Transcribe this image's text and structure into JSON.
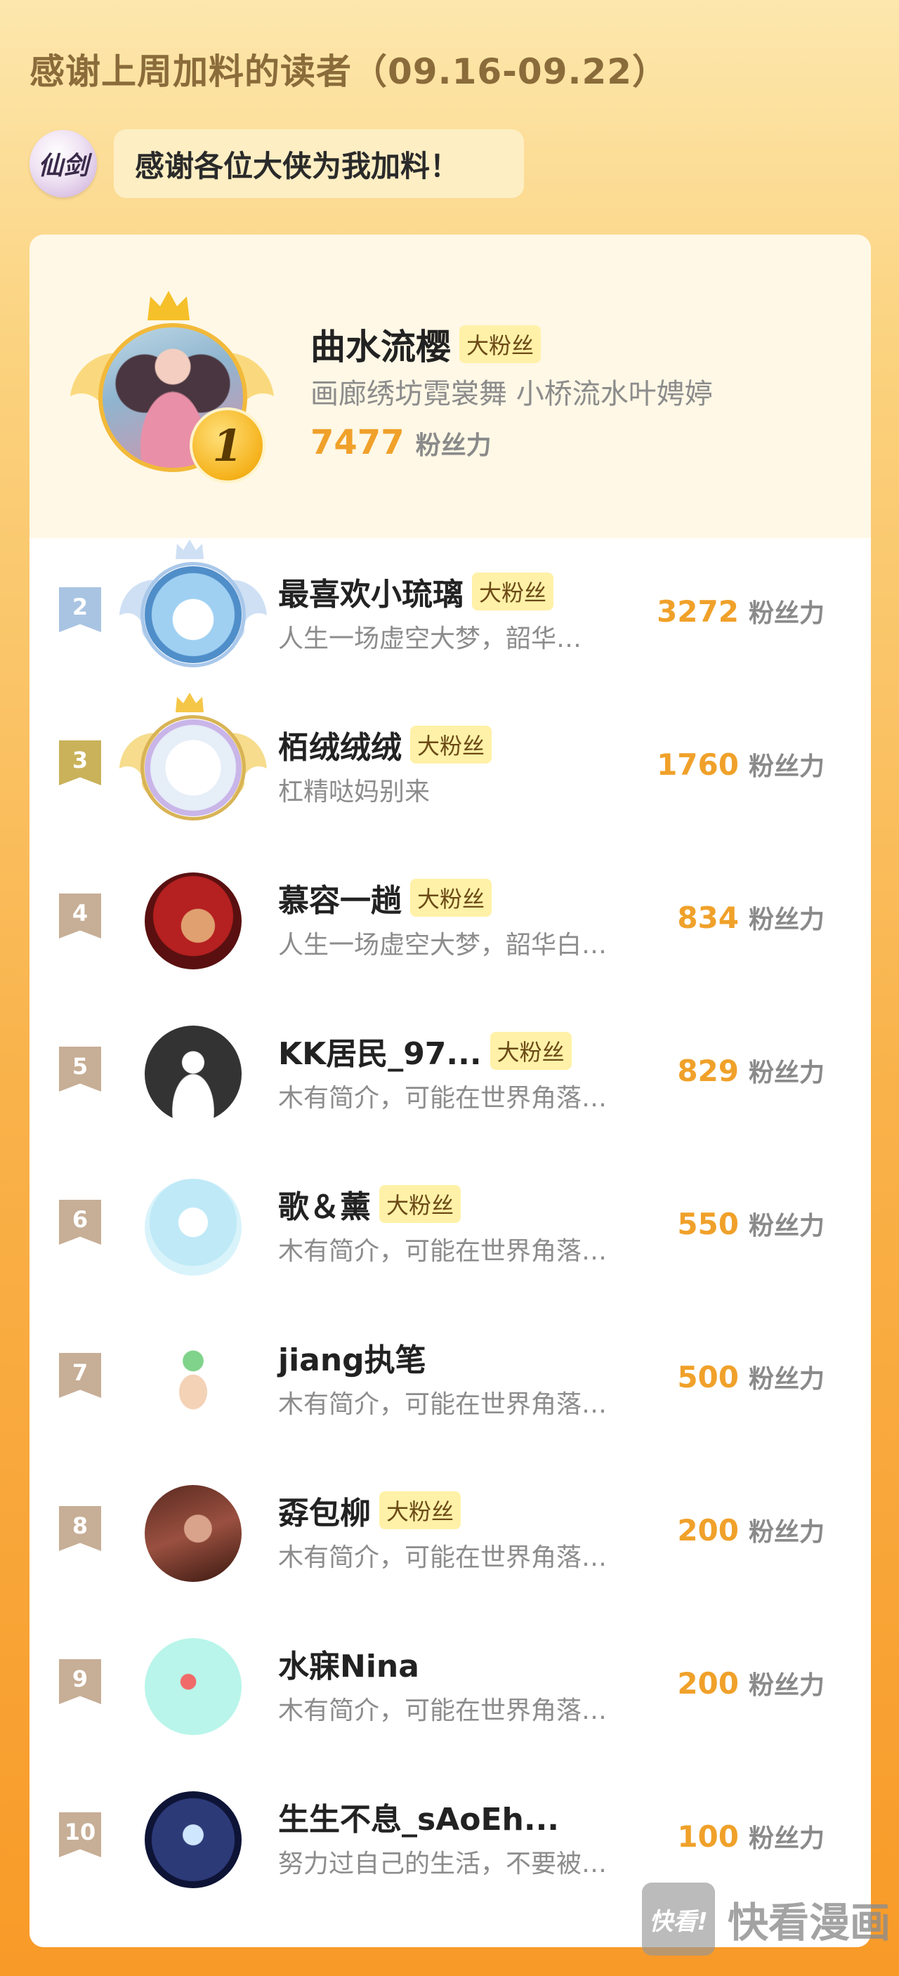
{
  "header": {
    "title": "感谢上周加料的读者（09.16-09.22）",
    "host_avatar_text": "仙剑",
    "speech": "感谢各位大侠为我加料！"
  },
  "unit_label": "粉丝力",
  "top": {
    "rank": "1",
    "name": "曲水流樱",
    "tag": "大粉丝",
    "bio": "画廊绣坊霓裳舞 小桥流水叶娉婷",
    "score": "7477"
  },
  "rows": [
    {
      "rank": "2",
      "name": "最喜欢小琉璃",
      "tag": "大粉丝",
      "bio": "人生一场虚空大梦，韶华…",
      "score": "3272",
      "flag_color": "#a9c4e2"
    },
    {
      "rank": "3",
      "name": "栢绒绒绒",
      "tag": "大粉丝",
      "bio": "杠精哒妈别来",
      "score": "1760",
      "flag_color": "#c9b25a"
    },
    {
      "rank": "4",
      "name": "慕容一趟",
      "tag": "大粉丝",
      "bio": "人生一场虚空大梦，韶华白…",
      "score": "834",
      "flag_color": "#c7ae96"
    },
    {
      "rank": "5",
      "name": "KK居民_97...",
      "tag": "大粉丝",
      "bio": "木有简介，可能在世界角落…",
      "score": "829",
      "flag_color": "#c7ae96"
    },
    {
      "rank": "6",
      "name": "歌＆薰",
      "tag": "大粉丝",
      "bio": "木有简介，可能在世界角落…",
      "score": "550",
      "flag_color": "#c7ae96"
    },
    {
      "rank": "7",
      "name": "jiang执笔",
      "tag": "",
      "bio": "木有简介，可能在世界角落…",
      "score": "500",
      "flag_color": "#c7ae96"
    },
    {
      "rank": "8",
      "name": "孬包柳",
      "tag": "大粉丝",
      "bio": "木有简介，可能在世界角落…",
      "score": "200",
      "flag_color": "#c7ae96"
    },
    {
      "rank": "9",
      "name": "水寐Nina",
      "tag": "",
      "bio": "木有简介，可能在世界角落…",
      "score": "200",
      "flag_color": "#c7ae96"
    },
    {
      "rank": "10",
      "name": "生生不息_sAoEh...",
      "tag": "",
      "bio": "努力过自己的生活，不要被…",
      "score": "100",
      "flag_color": "#c7ae96"
    }
  ],
  "watermark": {
    "logo": "快看!",
    "text": "快看漫画"
  }
}
